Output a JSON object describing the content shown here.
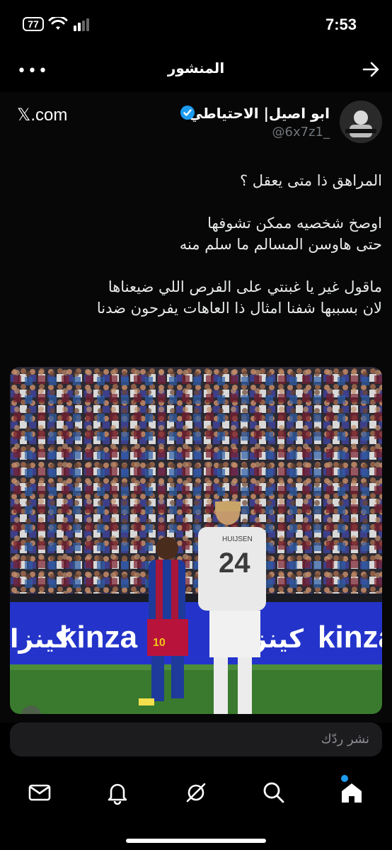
{
  "status_bar": {
    "battery": "77",
    "time": "7:53"
  },
  "header": {
    "title": "المنشور"
  },
  "post": {
    "source": "𝕏.com",
    "display_name": "ابو اصيل| الاحتياطي",
    "handle": "@6x7z1_",
    "paragraphs": [
      "المراهق ذا متى يعقل ؟",
      "اوصخ شخصيه ممكن تشوفها\nحتى هاوسن المسالم ما سلم منه",
      "ماقول غير يا غبنتي على الفرص اللي ضيعناها\nلان بسببها شفنا امثال ذا العاهات يفرحون ضدنا"
    ],
    "media": {
      "board_text_1": "kinza",
      "board_text_2": "كينزا",
      "left_number": "10",
      "right_number": "24",
      "right_name": "HUIJSEN"
    }
  },
  "reply": {
    "placeholder": "نشر ردّك"
  },
  "colors": {
    "accent": "#1d9bf0",
    "background": "#000000"
  }
}
